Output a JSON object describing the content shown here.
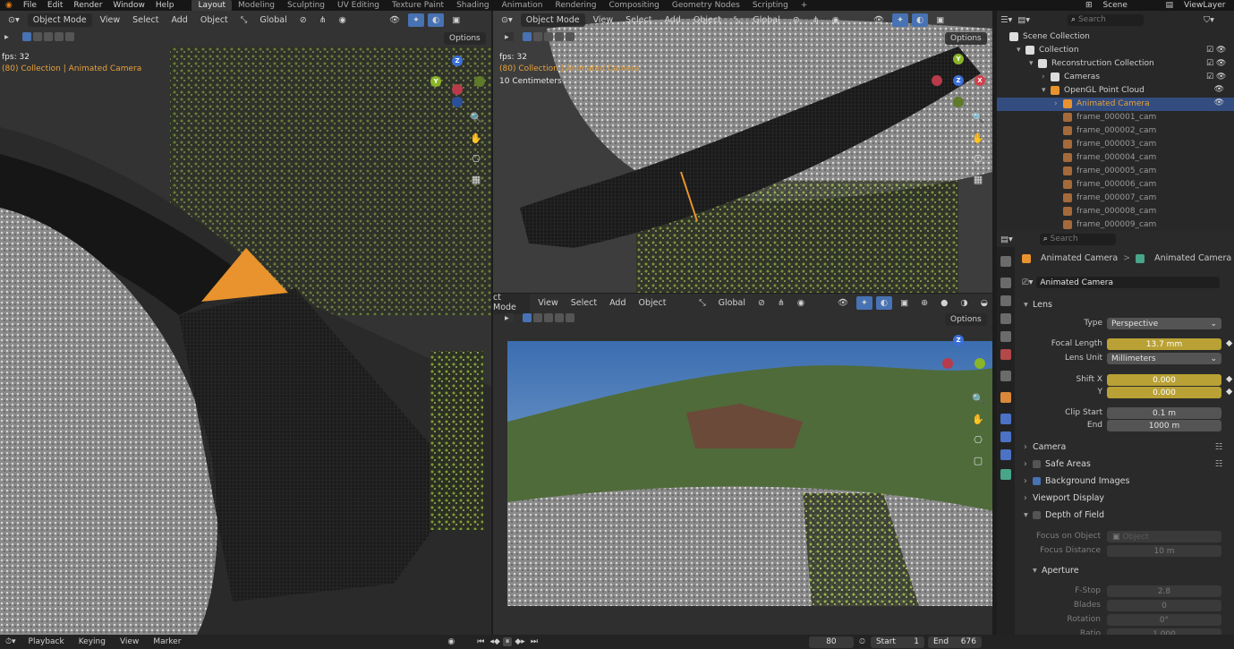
{
  "menu": [
    "File",
    "Edit",
    "Render",
    "Window",
    "Help"
  ],
  "workspaces": [
    {
      "label": "Layout",
      "active": true
    },
    {
      "label": "Modeling"
    },
    {
      "label": "Sculpting"
    },
    {
      "label": "UV Editing"
    },
    {
      "label": "Texture Paint"
    },
    {
      "label": "Shading"
    },
    {
      "label": "Animation"
    },
    {
      "label": "Rendering"
    },
    {
      "label": "Compositing"
    },
    {
      "label": "Geometry Nodes"
    },
    {
      "label": "Scripting"
    }
  ],
  "add_workspace": "+",
  "scene": {
    "label": "Scene",
    "viewlayer": "ViewLayer"
  },
  "vp_left": {
    "mode": "Object Mode",
    "view": "View",
    "select": "Select",
    "add": "Add",
    "object": "Object",
    "orientation": "Global",
    "options": "Options",
    "fps": "fps: 32",
    "collection": "(80) Collection | Animated Camera"
  },
  "vp_topright": {
    "mode": "Object Mode",
    "view": "View",
    "select": "Select",
    "add": "Add",
    "object": "Object",
    "orientation": "Global",
    "options": "Options",
    "fps": "fps: 32",
    "collection": "(80) Collection | Animated Camera",
    "scale": "10 Centimeters"
  },
  "vp_bottom": {
    "mode": "ct Mode",
    "view": "View",
    "select": "Select",
    "add": "Add",
    "object": "Object",
    "orientation": "Global",
    "options": "Options"
  },
  "outliner": {
    "search_placeholder": "Search",
    "items": [
      {
        "label": "Scene Collection"
      },
      {
        "label": "Collection"
      },
      {
        "label": "Reconstruction Collection"
      },
      {
        "label": "Cameras"
      },
      {
        "label": "OpenGL Point Cloud"
      },
      {
        "label": "Animated Camera",
        "selected": true
      },
      {
        "label": "frame_000001_cam"
      },
      {
        "label": "frame_000002_cam"
      },
      {
        "label": "frame_000003_cam"
      },
      {
        "label": "frame_000004_cam"
      },
      {
        "label": "frame_000005_cam"
      },
      {
        "label": "frame_000006_cam"
      },
      {
        "label": "frame_000007_cam"
      },
      {
        "label": "frame_000008_cam"
      },
      {
        "label": "frame_000009_cam"
      }
    ]
  },
  "properties": {
    "search_placeholder": "Search",
    "breadcrumb_obj": "Animated Camera",
    "breadcrumb_sep": ">",
    "breadcrumb_data": "Animated Camera",
    "data_name": "Animated Camera",
    "lens": {
      "title": "Lens",
      "type_label": "Type",
      "type_value": "Perspective",
      "focal_label": "Focal Length",
      "focal_value": "13.7 mm",
      "unit_label": "Lens Unit",
      "unit_value": "Millimeters",
      "shiftx_label": "Shift X",
      "shiftx_value": "0.000",
      "shifty_label": "Y",
      "shifty_value": "0.000",
      "clipstart_label": "Clip Start",
      "clipstart_value": "0.1 m",
      "clipend_label": "End",
      "clipend_value": "1000 m"
    },
    "sections": {
      "camera": "Camera",
      "safe": "Safe Areas",
      "bg": "Background Images",
      "viewport": "Viewport Display",
      "dof": "Depth of Field"
    },
    "dof": {
      "focus_obj_label": "Focus on Object",
      "focus_obj_ph": "Object",
      "focus_dist_label": "Focus Distance",
      "focus_dist_value": "10 m"
    },
    "aperture": {
      "title": "Aperture",
      "fstop_label": "F-Stop",
      "fstop_value": "2.8",
      "blades_label": "Blades",
      "blades_value": "0",
      "rotation_label": "Rotation",
      "rotation_value": "0°",
      "ratio_label": "Ratio",
      "ratio_value": "1.000"
    }
  },
  "timeline": {
    "playback": "Playback",
    "keying": "Keying",
    "view": "View",
    "marker": "Marker",
    "current": "80",
    "start_label": "Start",
    "start": "1",
    "end_label": "End",
    "end": "676"
  },
  "colors": {
    "accent": "#4772b3",
    "animated": "#b9a135",
    "selection": "#e8a23a"
  }
}
